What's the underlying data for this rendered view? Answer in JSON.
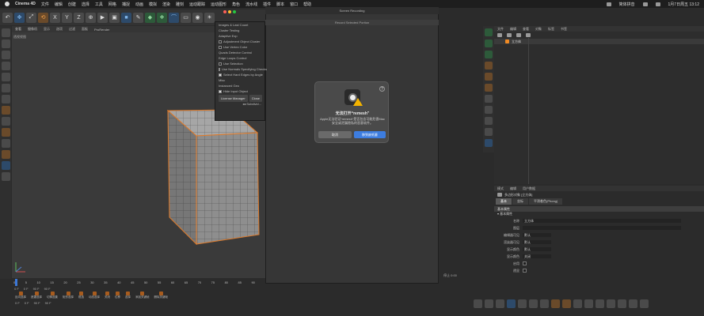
{
  "menubar": {
    "app": "Cinema 4D",
    "items": [
      "文件",
      "编辑",
      "创建",
      "选择",
      "工具",
      "网格",
      "捕捉",
      "动画",
      "模拟",
      "渲染",
      "雕刻",
      "运动跟踪",
      "运动图形",
      "角色",
      "流水线",
      "插件",
      "脚本",
      "窗口",
      "帮助"
    ],
    "clock": "1月7日周五 13:12",
    "input_method": "简体拼音"
  },
  "toolbar": {
    "undo": "↶",
    "move": "✥",
    "scale": "⤢",
    "rotate": "⟲",
    "axes_x": "X",
    "axes_y": "Y",
    "axes_z": "Z",
    "world": "⊕",
    "render": "▶",
    "render_view": "▣",
    "cube": "■",
    "pen": "✎",
    "subdiv": "◆",
    "array": "❖",
    "deform": "⌒",
    "floor": "▭",
    "camera": "◉",
    "light": "☀"
  },
  "viewport": {
    "menu": [
      "查看",
      "摄像机",
      "显示",
      "选项",
      "过滤",
      "面板",
      "ProRender"
    ],
    "name": "透视视图"
  },
  "recording_window": {
    "title": "Screen Recording",
    "subtitle": "Record Selected Portion"
  },
  "dropdown": {
    "items": [
      {
        "label": "Images & Last Count",
        "check": null
      },
      {
        "label": "Cluster Testing",
        "check": null
      },
      {
        "label": "Adaptive Exp",
        "check": null
      },
      {
        "label": "Adjustment Object Cluster",
        "check": false
      },
      {
        "label": "Use Vertex Color",
        "check": false
      },
      {
        "label": "Quads Detector Control",
        "check": null
      },
      {
        "label": "Edge Loops Control",
        "check": null
      },
      {
        "label": "Use Selection",
        "check": false
      },
      {
        "label": "Use Normals Specifying Checks",
        "check": false
      },
      {
        "label": "Select Hard Edges by Angle",
        "check": true
      },
      {
        "label": "Misc",
        "check": null
      },
      {
        "label": "Instanced Geo",
        "check": null
      },
      {
        "label": "Hide Input Object",
        "check": true
      }
    ],
    "license_button": "License Manager",
    "close_button": "Close",
    "footer": "◂◂  Subdivid..."
  },
  "dialog": {
    "title": "无法打开“remesh”",
    "message": "Apple无法验证“remesh”是否包含可能危害Mac安全或泄漏隐私的恶意软件。",
    "cancel": "取消",
    "ok": "移到废纸篓",
    "help": "?"
  },
  "objects_panel": {
    "tabs": [
      "文件",
      "编辑",
      "查看",
      "对象",
      "标签",
      "书签"
    ],
    "object_name": "立方体"
  },
  "attributes": {
    "tabs": [
      "模式",
      "编辑",
      "用户数据"
    ],
    "object_label": "多边形对象 [立方体]",
    "modes": [
      "基本",
      "坐标",
      "平滑着色(Phong)"
    ],
    "section": "基本属性",
    "subsection": "▾ 基本属性",
    "rows": [
      {
        "label": "名称",
        "value": "立方体",
        "kind": "wide"
      },
      {
        "label": "图层",
        "value": "",
        "kind": "wide"
      },
      {
        "label": "编辑器可见",
        "value": "默认",
        "kind": "val"
      },
      {
        "label": "渲染器可见",
        "value": "默认",
        "kind": "val"
      },
      {
        "label": "显示颜色",
        "value": "默认",
        "kind": "val"
      },
      {
        "label": "显示颜色",
        "value": "关闭",
        "kind": "val"
      },
      {
        "label": "启用",
        "value": "",
        "kind": "cbx"
      },
      {
        "label": "透显",
        "value": "",
        "kind": "cbx"
      }
    ]
  },
  "timeline": {
    "ticks": [
      "0",
      "5",
      "10",
      "15",
      "20",
      "25",
      "30",
      "35",
      "40",
      "45",
      "50",
      "55",
      "60",
      "65",
      "70",
      "75",
      "80",
      "85",
      "90"
    ],
    "frames": [
      "0 F",
      "0 F",
      "90 F",
      "90 F"
    ],
    "keys": [
      "反向选择",
      "遮罩选择",
      "切换选集",
      "矩形选择",
      "框选",
      "动态选择",
      "关闭",
      "位移",
      "选择",
      "添加关键帧",
      "删除关键帧"
    ],
    "status": [
      "0 F",
      "0 F",
      "90 F",
      "90 F"
    ],
    "recording_footer": "停止 0:00"
  }
}
